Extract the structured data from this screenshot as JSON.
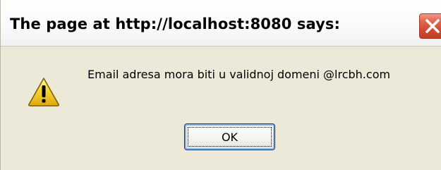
{
  "dialog": {
    "title": "The page at http://localhost:8080 says:",
    "message": "Email adresa mora biti u validnoj domeni @lrcbh.com",
    "ok_label": "OK",
    "icons": {
      "warning": "warning-icon",
      "close": "close-icon"
    },
    "colors": {
      "dialog_background": "#ece9d8",
      "close_button": "#d24a30",
      "warning_yellow": "#f5d431"
    }
  }
}
